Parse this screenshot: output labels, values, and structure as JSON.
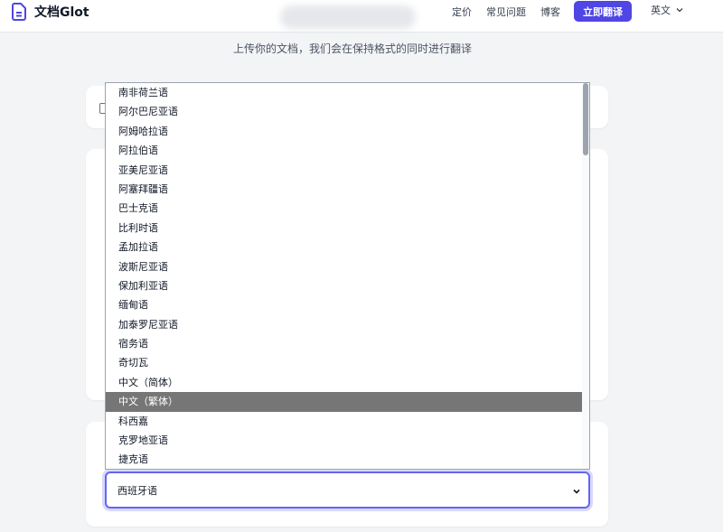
{
  "header": {
    "brand_name": "文档Glot",
    "nav": [
      {
        "label": "定价"
      },
      {
        "label": "常见问题"
      },
      {
        "label": "博客"
      }
    ],
    "cta_label": "立即翻译",
    "language": "英文"
  },
  "subtitle": "上传你的文档，我们会在保持格式的同时进行翻译",
  "dropdown": {
    "options": [
      "南非荷兰语",
      "阿尔巴尼亚语",
      "阿姆哈拉语",
      "阿拉伯语",
      "亚美尼亚语",
      "阿塞拜疆语",
      "巴士克语",
      "比利时语",
      "孟加拉语",
      "波斯尼亚语",
      "保加利亚语",
      "缅甸语",
      "加泰罗尼亚语",
      "宿务语",
      "奇切瓦",
      "中文（简体）",
      "中文（繁体）",
      "科西嘉",
      "克罗地亚语",
      "捷克语"
    ],
    "highlighted": "中文（繁体）"
  },
  "target_language": {
    "selected": "西班牙语"
  },
  "colors": {
    "accent": "#4f46e5",
    "focus_ring": "#6366f1",
    "highlight": "#767676"
  }
}
